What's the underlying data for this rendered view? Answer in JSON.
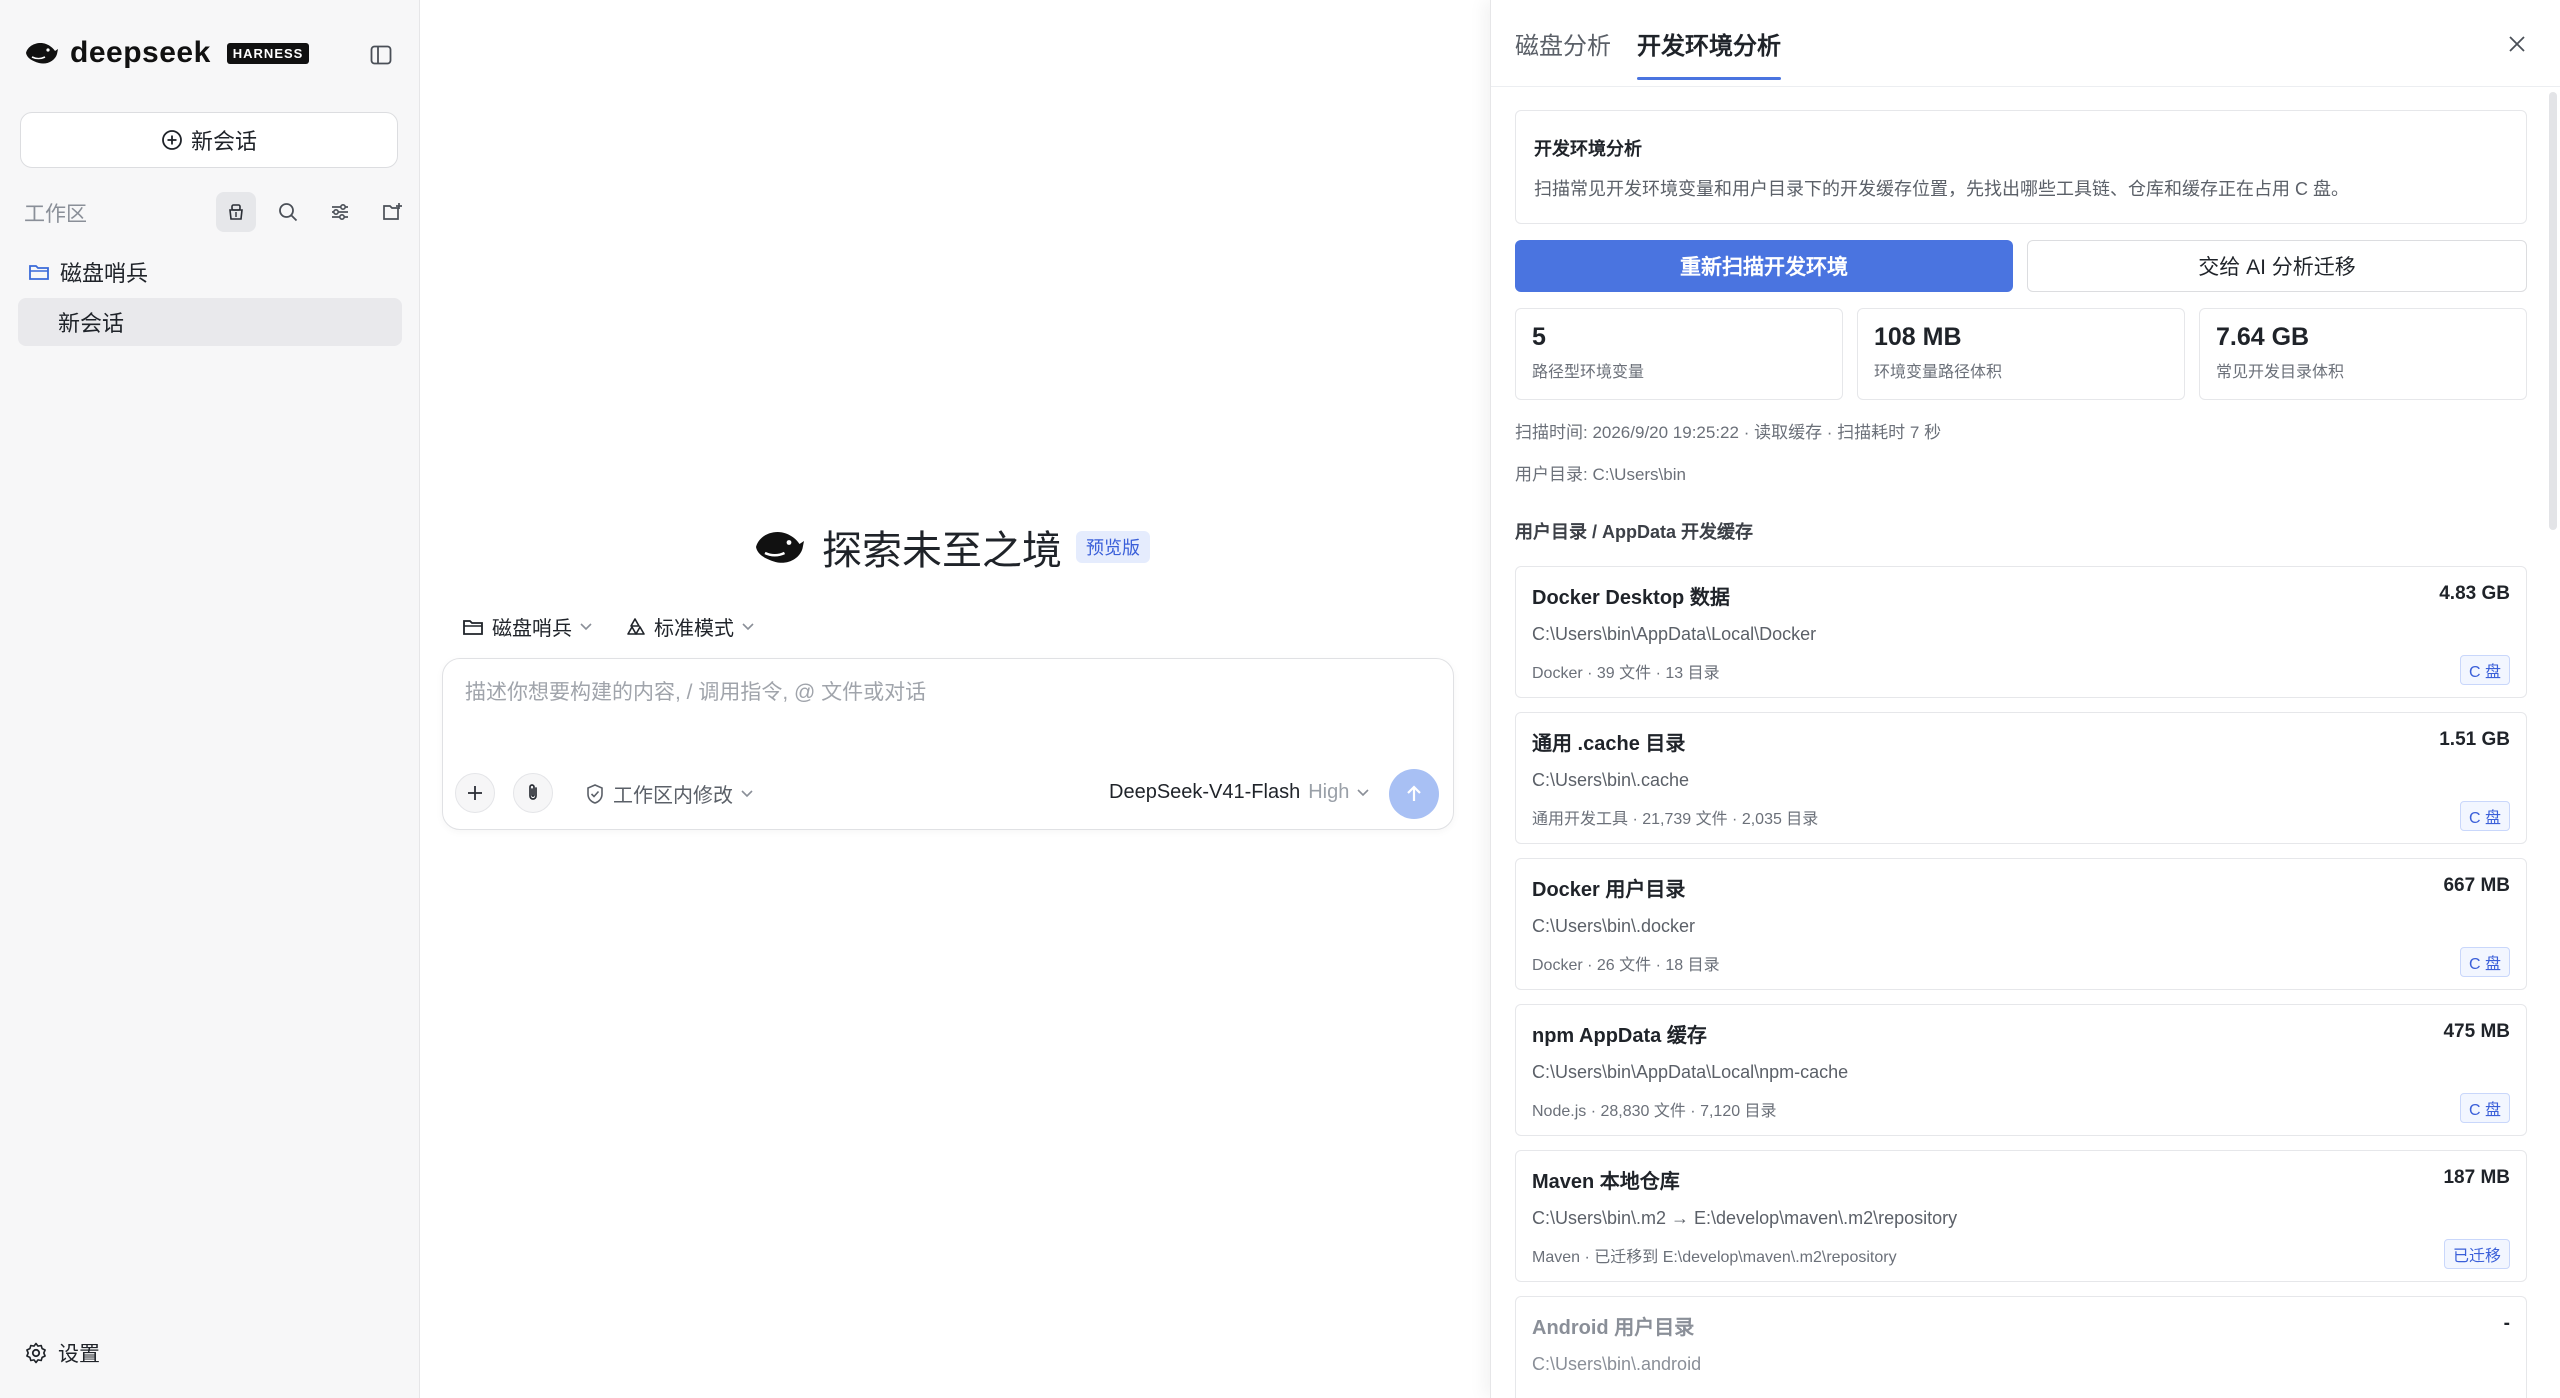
{
  "sidebar": {
    "brand": "deepseek",
    "badge": "HARNESS",
    "new_chat": "新会话",
    "workspace_label": "工作区",
    "folder": "磁盘哨兵",
    "session": "新会话",
    "settings": "设置"
  },
  "main": {
    "hero_title": "探索未至之境",
    "hero_badge": "预览版",
    "context_folder": "磁盘哨兵",
    "context_mode": "标准模式",
    "composer_placeholder": "描述你想要构建的内容, / 调用指令, @ 文件或对话",
    "scope": "工作区内修改",
    "model": "DeepSeek-V41-Flash",
    "model_level": "High"
  },
  "panel": {
    "tabs": [
      "磁盘分析",
      "开发环境分析"
    ],
    "intro_title": "开发环境分析",
    "intro_desc": "扫描常见开发环境变量和用户目录下的开发缓存位置，先找出哪些工具链、仓库和缓存正在占用 C 盘。",
    "rescan_button": "重新扫描开发环境",
    "ai_button": "交给 AI 分析迁移",
    "stats": [
      {
        "value": "5",
        "label": "路径型环境变量"
      },
      {
        "value": "108 MB",
        "label": "环境变量路径体积"
      },
      {
        "value": "7.64 GB",
        "label": "常见开发目录体积"
      }
    ],
    "scan_info": "扫描时间: 2026/9/20 19:25:22 · 读取缓存 · 扫描耗时 7 秒",
    "user_dir": "用户目录: C:\\Users\\bin",
    "section_title": "用户目录 / AppData 开发缓存",
    "cards": [
      {
        "name": "Docker Desktop 数据",
        "size": "4.83 GB",
        "path": "C:\\Users\\bin\\AppData\\Local\\Docker",
        "sub": "Docker · 39 文件 · 13 目录",
        "tag": "C 盘"
      },
      {
        "name": "通用 .cache 目录",
        "size": "1.51 GB",
        "path": "C:\\Users\\bin\\.cache",
        "sub": "通用开发工具 · 21,739 文件 · 2,035 目录",
        "tag": "C 盘"
      },
      {
        "name": "Docker 用户目录",
        "size": "667 MB",
        "path": "C:\\Users\\bin\\.docker",
        "sub": "Docker · 26 文件 · 18 目录",
        "tag": "C 盘"
      },
      {
        "name": "npm AppData 缓存",
        "size": "475 MB",
        "path": "C:\\Users\\bin\\AppData\\Local\\npm-cache",
        "sub": "Node.js · 28,830 文件 · 7,120 目录",
        "tag": "C 盘"
      },
      {
        "name": "Maven 本地仓库",
        "size": "187 MB",
        "path": "C:\\Users\\bin\\.m2 → E:\\develop\\maven\\.m2\\repository",
        "sub": "Maven · 已迁移到 E:\\develop\\maven\\.m2\\repository",
        "tag": "已迁移"
      },
      {
        "name": "Android 用户目录",
        "size": "-",
        "path": "C:\\Users\\bin\\.android",
        "sub": "",
        "tag": ""
      }
    ]
  }
}
